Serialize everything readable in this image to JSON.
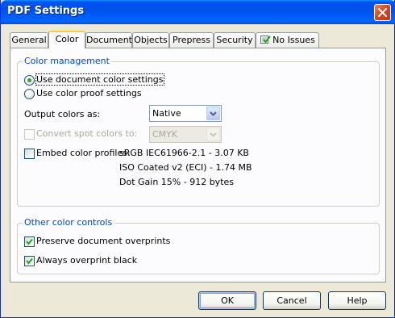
{
  "window": {
    "title": "PDF Settings"
  },
  "tabs": [
    {
      "label": "General"
    },
    {
      "label": "Color"
    },
    {
      "label": "Document"
    },
    {
      "label": "Objects"
    },
    {
      "label": "Prepress"
    },
    {
      "label": "Security"
    },
    {
      "label": "No Issues"
    }
  ],
  "active_tab": "Color",
  "color_management": {
    "title": "Color management",
    "radio_document": "Use document color settings",
    "radio_proof": "Use color proof settings",
    "selected_radio": "document",
    "output_label": "Output colors as:",
    "output_value": "Native",
    "spot_label": "Convert spot colors to:",
    "spot_value": "CMYK",
    "spot_checked": false,
    "spot_enabled": false,
    "embed_label": "Embed color profiles:",
    "embed_checked": false,
    "profiles": [
      "sRGB IEC61966-2.1 - 3.07 KB",
      "ISO Coated v2 (ECI) - 1.74 MB",
      "Dot Gain 15% - 912 bytes"
    ]
  },
  "other_controls": {
    "title": "Other color controls",
    "preserve_label": "Preserve document overprints",
    "preserve_checked": true,
    "always_label": "Always overprint black",
    "always_checked": true
  },
  "buttons": {
    "ok": "OK",
    "cancel": "Cancel",
    "help": "Help"
  },
  "colors": {
    "titlebar": "#0054e3",
    "group_label": "#0046d5",
    "active_tab_highlight": "#ffc83c",
    "check_mark": "#21a121",
    "close_button": "#d64b23"
  },
  "icons": {
    "close": "close-icon",
    "no_issues": "checklist-icon"
  }
}
